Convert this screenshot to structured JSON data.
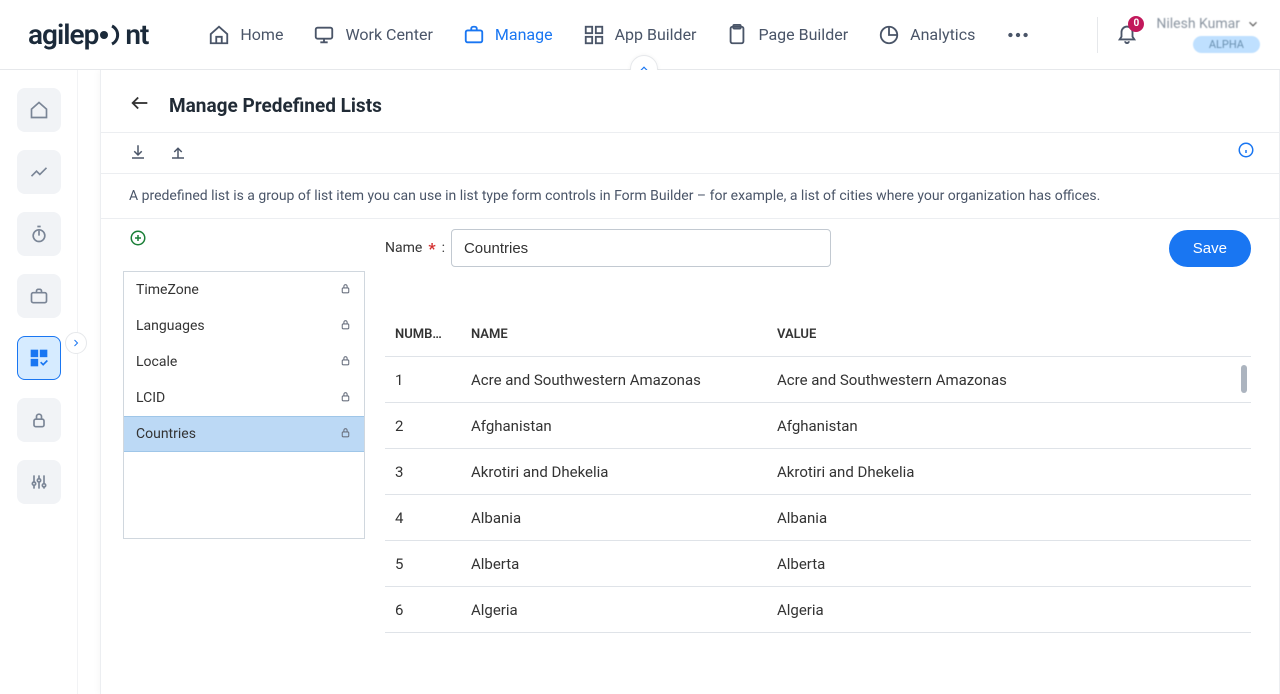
{
  "nav": {
    "home": "Home",
    "work_center": "Work Center",
    "manage": "Manage",
    "app_builder": "App Builder",
    "page_builder": "Page Builder",
    "analytics": "Analytics"
  },
  "notifications": {
    "count": "0"
  },
  "user": {
    "name": "Nilesh Kumar",
    "badge": "ALPHA"
  },
  "page": {
    "title": "Manage Predefined Lists",
    "description": "A predefined list is a group of list item you can use in list type form controls in Form Builder – for example, a list of cities where your organization has offices."
  },
  "form": {
    "name_label": "Name",
    "name_value": "Countries",
    "save_label": "Save"
  },
  "lists": [
    {
      "label": "TimeZone",
      "locked": true,
      "selected": false
    },
    {
      "label": "Languages",
      "locked": true,
      "selected": false
    },
    {
      "label": "Locale",
      "locked": true,
      "selected": false
    },
    {
      "label": "LCID",
      "locked": true,
      "selected": false
    },
    {
      "label": "Countries",
      "locked": true,
      "selected": true
    }
  ],
  "grid": {
    "headers": {
      "number": "NUMB…",
      "name": "NAME",
      "value": "VALUE"
    },
    "rows": [
      {
        "num": "1",
        "name": "Acre and Southwestern Amazonas",
        "value": "Acre and Southwestern Amazonas"
      },
      {
        "num": "2",
        "name": "Afghanistan",
        "value": "Afghanistan"
      },
      {
        "num": "3",
        "name": "Akrotiri and Dhekelia",
        "value": "Akrotiri and Dhekelia"
      },
      {
        "num": "4",
        "name": "Albania",
        "value": "Albania"
      },
      {
        "num": "5",
        "name": "Alberta",
        "value": "Alberta"
      },
      {
        "num": "6",
        "name": "Algeria",
        "value": "Algeria"
      }
    ]
  }
}
